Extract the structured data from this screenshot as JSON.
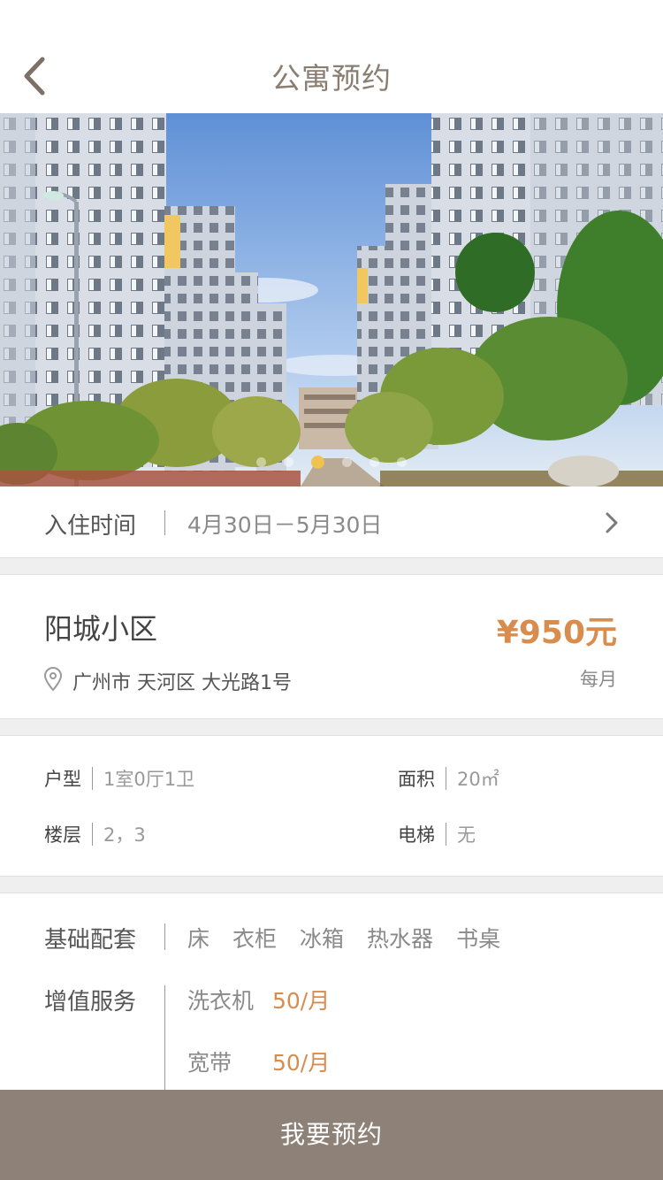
{
  "header": {
    "title": "公寓预约",
    "back_icon": "chevron-left-icon"
  },
  "carousel": {
    "slide_count": 6,
    "active_index": 2,
    "active_color": "#f0c250"
  },
  "checkin": {
    "label": "入住时间",
    "value": "4月30日－5月30日",
    "chevron_icon": "chevron-right-icon"
  },
  "listing": {
    "name": "阳城小区",
    "price": "¥950元",
    "price_unit": "每月",
    "address": "广州市 天河区 大光路1号",
    "location_icon": "map-pin-icon"
  },
  "specs": {
    "layout_label": "户型",
    "layout_value": "1室0厅1卫",
    "area_label": "面积",
    "area_value": "20㎡",
    "floor_label": "楼层",
    "floor_value": "2，3",
    "elevator_label": "电梯",
    "elevator_value": "无"
  },
  "amenities": {
    "basic_label": "基础配套",
    "basic_items": [
      "床",
      "衣柜",
      "冰箱",
      "热水器",
      "书桌"
    ],
    "service_label": "增值服务",
    "services": [
      {
        "name": "洗衣机",
        "price": "50/月"
      },
      {
        "name": "宽带",
        "price": "50/月"
      }
    ]
  },
  "cta": {
    "label": "我要预约"
  },
  "colors": {
    "accent": "#d88c4d",
    "button": "#8e8178",
    "title": "#8a7e73"
  }
}
